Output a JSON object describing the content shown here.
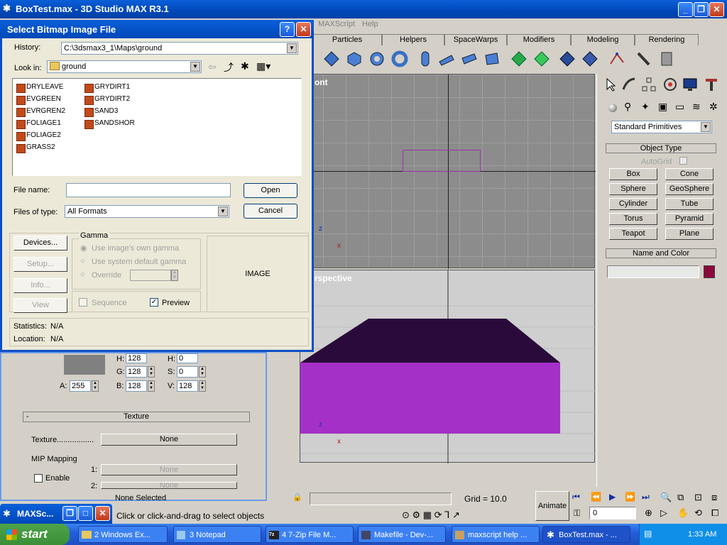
{
  "app": {
    "title": "BoxTest.max - 3D Studio MAX R3.1",
    "menus": [
      "MAXScript",
      "Help"
    ]
  },
  "tabs": [
    "Particles",
    "Helpers",
    "SpaceWarps",
    "Modifiers",
    "Modeling",
    "Rendering"
  ],
  "viewports": {
    "front_label": "ont",
    "perspective_label": "rspective",
    "axis_z": "z",
    "axis_x": "x"
  },
  "command_panel": {
    "category": "Standard Primitives",
    "object_type_header": "Object Type",
    "autogrid": "AutoGrid",
    "buttons": [
      "Box",
      "Cone",
      "Sphere",
      "GeoSphere",
      "Cylinder",
      "Tube",
      "Torus",
      "Pyramid",
      "Teapot",
      "Plane"
    ],
    "name_color_header": "Name and Color",
    "color": "#8b0a3a"
  },
  "dialog": {
    "title": "Select Bitmap Image File",
    "history_label": "History:",
    "history_value": "C:\\3dsmax3_1\\Maps\\ground",
    "lookin_label": "Look in:",
    "lookin_value": "ground",
    "files_col1": [
      "DRYLEAVE",
      "EVGREEN",
      "EVRGREN2",
      "FOLIAGE1",
      "FOLIAGE2",
      "GRASS2"
    ],
    "files_col2": [
      "GRYDIRT1",
      "GRYDIRT2",
      "SAND3",
      "SANDSHOR"
    ],
    "filename_label": "File name:",
    "filename_value": "",
    "filetype_label": "Files of type:",
    "filetype_value": "All Formats",
    "open": "Open",
    "cancel": "Cancel",
    "devices": "Devices...",
    "setup": "Setup...",
    "info": "Info...",
    "view": "View",
    "gamma_label": "Gamma",
    "gamma_own": "Use image's own gamma",
    "gamma_system": "Use system default gamma",
    "gamma_override": "Override",
    "sequence": "Sequence",
    "preview": "Preview",
    "image_label": "IMAGE",
    "statistics_label": "Statistics:",
    "statistics_value": "N/A",
    "location_label": "Location:",
    "location_value": "N/A"
  },
  "material_panel": {
    "h_label": "H:",
    "h_value": "128",
    "h2_label": "H:",
    "h2_value": "0",
    "g_label": "G:",
    "g_value": "128",
    "s_label": "S:",
    "s_value": "0",
    "a_label": "A:",
    "a_value": "255",
    "b_label": "B:",
    "b_value": "128",
    "v_label": "V:",
    "v_value": "128",
    "texture_header": "Texture",
    "texture_label": "Texture.................",
    "texture_value": "None",
    "mip_label": "MIP Mapping",
    "enable": "Enable",
    "mip_1": "1:",
    "mip_1_value": "None",
    "mip_2": "2:",
    "mip_2_value": "None",
    "none_selected": "None Selected"
  },
  "statusbar": {
    "grid": "Grid = 10.0",
    "prompt": "Click or click-and-drag to select objects",
    "animate": "Animate",
    "frame": "0"
  },
  "maxscript_window": {
    "title": "MAXSc..."
  },
  "taskbar": {
    "start": "start",
    "tasks": [
      "2 Windows Ex...",
      "3 Notepad",
      "4 7-Zip File M...",
      "Makefile - Dev-...",
      "maxscript help ...",
      "BoxTest.max - ..."
    ],
    "clock": "1:33 AM"
  }
}
